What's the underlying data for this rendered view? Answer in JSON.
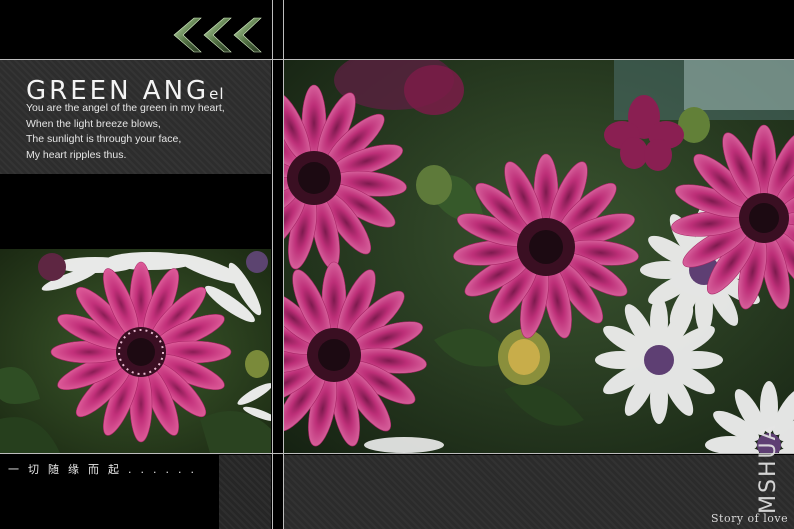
{
  "header": {
    "title_main": "GREEN ANG",
    "title_tail": "el",
    "arrows_icon": "triple-chevron-left-icon"
  },
  "poem": {
    "lines": [
      "You are the angel of the green in my heart,",
      "When the light breeze blows,",
      "The sunlight is through your face,",
      "My heart ripples thus."
    ]
  },
  "footer": {
    "chinese_caption": "一切随缘而起......",
    "story": "Story of love",
    "watermark": "MSHUA"
  },
  "colors": {
    "background": "#000000",
    "panel": "#2d2d2d",
    "petal_magenta": "#c8327a",
    "petal_white": "#f2f2f2",
    "foliage": "#2e4a26"
  },
  "photos": {
    "left_subject": "magenta-daisy-photo",
    "main_subject": "magenta-daisies-photo"
  }
}
